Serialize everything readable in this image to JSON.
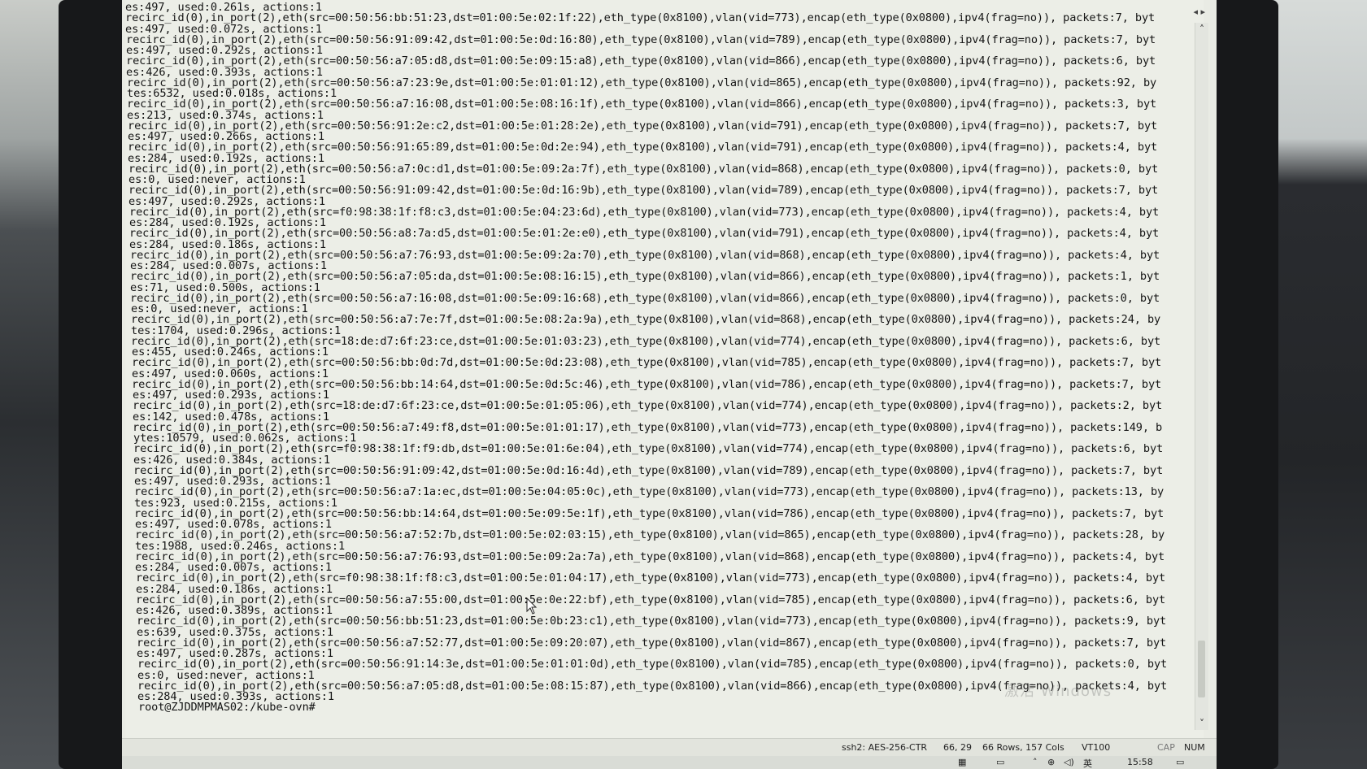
{
  "terminal": {
    "lines": [
      "es:497, used:0.261s, actions:1",
      "recirc_id(0),in_port(2),eth(src=00:50:56:bb:51:23,dst=01:00:5e:02:1f:22),eth_type(0x8100),vlan(vid=773),encap(eth_type(0x0800),ipv4(frag=no)), packets:7, byt",
      "es:497, used:0.072s, actions:1",
      "recirc_id(0),in_port(2),eth(src=00:50:56:91:09:42,dst=01:00:5e:0d:16:80),eth_type(0x8100),vlan(vid=789),encap(eth_type(0x0800),ipv4(frag=no)), packets:7, byt",
      "es:497, used:0.292s, actions:1",
      "recirc_id(0),in_port(2),eth(src=00:50:56:a7:05:d8,dst=01:00:5e:09:15:a8),eth_type(0x8100),vlan(vid=866),encap(eth_type(0x0800),ipv4(frag=no)), packets:6, byt",
      "es:426, used:0.393s, actions:1",
      "recirc_id(0),in_port(2),eth(src=00:50:56:a7:23:9e,dst=01:00:5e:01:01:12),eth_type(0x8100),vlan(vid=865),encap(eth_type(0x0800),ipv4(frag=no)), packets:92, by",
      "tes:6532, used:0.018s, actions:1",
      "recirc_id(0),in_port(2),eth(src=00:50:56:a7:16:08,dst=01:00:5e:08:16:1f),eth_type(0x8100),vlan(vid=866),encap(eth_type(0x0800),ipv4(frag=no)), packets:3, byt",
      "es:213, used:0.374s, actions:1",
      "recirc_id(0),in_port(2),eth(src=00:50:56:91:2e:c2,dst=01:00:5e:01:28:2e),eth_type(0x8100),vlan(vid=791),encap(eth_type(0x0800),ipv4(frag=no)), packets:7, byt",
      "es:497, used:0.266s, actions:1",
      "recirc_id(0),in_port(2),eth(src=00:50:56:91:65:89,dst=01:00:5e:0d:2e:94),eth_type(0x8100),vlan(vid=791),encap(eth_type(0x0800),ipv4(frag=no)), packets:4, byt",
      "es:284, used:0.192s, actions:1",
      "recirc_id(0),in_port(2),eth(src=00:50:56:a7:0c:d1,dst=01:00:5e:09:2a:7f),eth_type(0x8100),vlan(vid=868),encap(eth_type(0x0800),ipv4(frag=no)), packets:0, byt",
      "es:0, used:never, actions:1",
      "recirc_id(0),in_port(2),eth(src=00:50:56:91:09:42,dst=01:00:5e:0d:16:9b),eth_type(0x8100),vlan(vid=789),encap(eth_type(0x0800),ipv4(frag=no)), packets:7, byt",
      "es:497, used:0.292s, actions:1",
      "recirc_id(0),in_port(2),eth(src=f0:98:38:1f:f8:c3,dst=01:00:5e:04:23:6d),eth_type(0x8100),vlan(vid=773),encap(eth_type(0x0800),ipv4(frag=no)), packets:4, byt",
      "es:284, used:0.192s, actions:1",
      "recirc_id(0),in_port(2),eth(src=00:50:56:a8:7a:d5,dst=01:00:5e:01:2e:e0),eth_type(0x8100),vlan(vid=791),encap(eth_type(0x0800),ipv4(frag=no)), packets:4, byt",
      "es:284, used:0.186s, actions:1",
      "recirc_id(0),in_port(2),eth(src=00:50:56:a7:76:93,dst=01:00:5e:09:2a:70),eth_type(0x8100),vlan(vid=868),encap(eth_type(0x0800),ipv4(frag=no)), packets:4, byt",
      "es:284, used:0.007s, actions:1",
      "recirc_id(0),in_port(2),eth(src=00:50:56:a7:05:da,dst=01:00:5e:08:16:15),eth_type(0x8100),vlan(vid=866),encap(eth_type(0x0800),ipv4(frag=no)), packets:1, byt",
      "es:71, used:0.500s, actions:1",
      "recirc_id(0),in_port(2),eth(src=00:50:56:a7:16:08,dst=01:00:5e:09:16:68),eth_type(0x8100),vlan(vid=866),encap(eth_type(0x0800),ipv4(frag=no)), packets:0, byt",
      "es:0, used:never, actions:1",
      "recirc_id(0),in_port(2),eth(src=00:50:56:a7:7e:7f,dst=01:00:5e:08:2a:9a),eth_type(0x8100),vlan(vid=868),encap(eth_type(0x0800),ipv4(frag=no)), packets:24, by",
      "tes:1704, used:0.296s, actions:1",
      "recirc_id(0),in_port(2),eth(src=18:de:d7:6f:23:ce,dst=01:00:5e:01:03:23),eth_type(0x8100),vlan(vid=774),encap(eth_type(0x0800),ipv4(frag=no)), packets:6, byt",
      "es:455, used:0.246s, actions:1",
      "recirc_id(0),in_port(2),eth(src=00:50:56:bb:0d:7d,dst=01:00:5e:0d:23:08),eth_type(0x8100),vlan(vid=785),encap(eth_type(0x0800),ipv4(frag=no)), packets:7, byt",
      "es:497, used:0.060s, actions:1",
      "recirc_id(0),in_port(2),eth(src=00:50:56:bb:14:64,dst=01:00:5e:0d:5c:46),eth_type(0x8100),vlan(vid=786),encap(eth_type(0x0800),ipv4(frag=no)), packets:7, byt",
      "es:497, used:0.293s, actions:1",
      "recirc_id(0),in_port(2),eth(src=18:de:d7:6f:23:ce,dst=01:00:5e:01:05:06),eth_type(0x8100),vlan(vid=774),encap(eth_type(0x0800),ipv4(frag=no)), packets:2, byt",
      "es:142, used:0.478s, actions:1",
      "recirc_id(0),in_port(2),eth(src=00:50:56:a7:49:f8,dst=01:00:5e:01:01:17),eth_type(0x8100),vlan(vid=773),encap(eth_type(0x0800),ipv4(frag=no)), packets:149, b",
      "ytes:10579, used:0.062s, actions:1",
      "recirc_id(0),in_port(2),eth(src=f0:98:38:1f:f9:db,dst=01:00:5e:01:6e:04),eth_type(0x8100),vlan(vid=774),encap(eth_type(0x0800),ipv4(frag=no)), packets:6, byt",
      "es:426, used:0.384s, actions:1",
      "recirc_id(0),in_port(2),eth(src=00:50:56:91:09:42,dst=01:00:5e:0d:16:4d),eth_type(0x8100),vlan(vid=789),encap(eth_type(0x0800),ipv4(frag=no)), packets:7, byt",
      "es:497, used:0.293s, actions:1",
      "recirc_id(0),in_port(2),eth(src=00:50:56:a7:1a:ec,dst=01:00:5e:04:05:0c),eth_type(0x8100),vlan(vid=773),encap(eth_type(0x0800),ipv4(frag=no)), packets:13, by",
      "tes:923, used:0.215s, actions:1",
      "recirc_id(0),in_port(2),eth(src=00:50:56:bb:14:64,dst=01:00:5e:09:5e:1f),eth_type(0x8100),vlan(vid=786),encap(eth_type(0x0800),ipv4(frag=no)), packets:7, byt",
      "es:497, used:0.078s, actions:1",
      "recirc_id(0),in_port(2),eth(src=00:50:56:a7:52:7b,dst=01:00:5e:02:03:15),eth_type(0x8100),vlan(vid=865),encap(eth_type(0x0800),ipv4(frag=no)), packets:28, by",
      "tes:1988, used:0.246s, actions:1",
      "recirc_id(0),in_port(2),eth(src=00:50:56:a7:76:93,dst=01:00:5e:09:2a:7a),eth_type(0x8100),vlan(vid=868),encap(eth_type(0x0800),ipv4(frag=no)), packets:4, byt",
      "es:284, used:0.007s, actions:1",
      "recirc_id(0),in_port(2),eth(src=f0:98:38:1f:f8:c3,dst=01:00:5e:01:04:17),eth_type(0x8100),vlan(vid=773),encap(eth_type(0x0800),ipv4(frag=no)), packets:4, byt",
      "es:284, used:0.186s, actions:1",
      "recirc_id(0),in_port(2),eth(src=00:50:56:a7:55:00,dst=01:00:5e:0e:22:bf),eth_type(0x8100),vlan(vid=785),encap(eth_type(0x0800),ipv4(frag=no)), packets:6, byt",
      "es:426, used:0.389s, actions:1",
      "recirc_id(0),in_port(2),eth(src=00:50:56:bb:51:23,dst=01:00:5e:0b:23:c1),eth_type(0x8100),vlan(vid=773),encap(eth_type(0x0800),ipv4(frag=no)), packets:9, byt",
      "es:639, used:0.375s, actions:1",
      "recirc_id(0),in_port(2),eth(src=00:50:56:a7:52:77,dst=01:00:5e:09:20:07),eth_type(0x8100),vlan(vid=867),encap(eth_type(0x0800),ipv4(frag=no)), packets:7, byt",
      "es:497, used:0.287s, actions:1",
      "recirc_id(0),in_port(2),eth(src=00:50:56:91:14:3e,dst=01:00:5e:01:01:0d),eth_type(0x8100),vlan(vid=785),encap(eth_type(0x0800),ipv4(frag=no)), packets:0, byt",
      "es:0, used:never, actions:1",
      "recirc_id(0),in_port(2),eth(src=00:50:56:a7:05:d8,dst=01:00:5e:08:15:87),eth_type(0x8100),vlan(vid=866),encap(eth_type(0x0800),ipv4(frag=no)), packets:4, byt",
      "es:284, used:0.393s, actions:1",
      "root@ZJDDMPMAS02:/kube-ovn#"
    ]
  },
  "status_bar": {
    "ssh": "ssh2: AES-256-CTR",
    "cursor_pos": "66, 29",
    "dimensions": "66 Rows, 157 Cols",
    "terminal_type": "VT100",
    "caps": "CAP",
    "num": "NUM"
  },
  "taskbar": {
    "clock": "15:58",
    "ime": "英"
  },
  "watermark": "激活 Windows",
  "icons": [
    "scroll-up-icon",
    "scroll-down-icon",
    "tab-left-icon",
    "tab-right-icon",
    "mouse-cursor-icon",
    "taskbar-grid-icon",
    "network-icon",
    "volume-icon",
    "notification-icon"
  ]
}
